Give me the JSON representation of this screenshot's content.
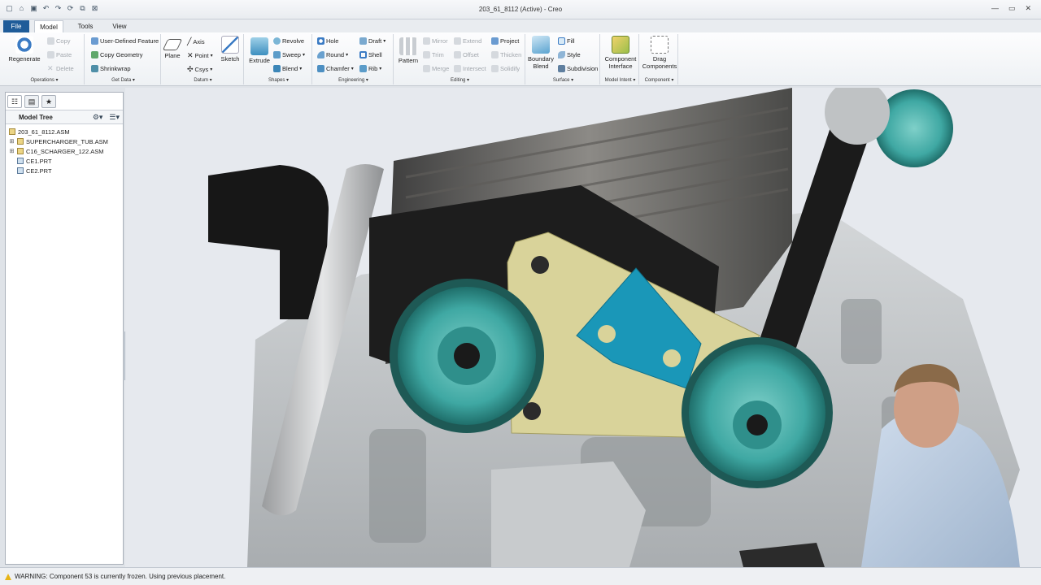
{
  "window": {
    "title": "203_61_8112 (Active) - Creo"
  },
  "quick_access": [
    "new-icon",
    "open-icon",
    "save-icon",
    "undo-icon",
    "redo-icon",
    "regenerate-icon",
    "windows-icon",
    "close-icon"
  ],
  "tabs": [
    {
      "label": "File"
    },
    {
      "label": "Model"
    },
    {
      "label": "Tools"
    },
    {
      "label": "View"
    }
  ],
  "ribbon": {
    "operations": {
      "label": "Operations ▾",
      "regenerate": "Regenerate",
      "copy": "Copy",
      "paste": "Paste",
      "delete": "Delete"
    },
    "get_data": {
      "label": "Get Data ▾",
      "udf": "User-Defined Feature",
      "copy_geometry": "Copy Geometry",
      "shrinkwrap": "Shrinkwrap"
    },
    "datum": {
      "label": "Datum ▾",
      "plane": "Plane",
      "axis": "Axis",
      "point": "Point",
      "csys": "Csys",
      "sketch": "Sketch"
    },
    "shapes": {
      "label": "Shapes ▾",
      "extrude": "Extrude",
      "revolve": "Revolve",
      "sweep": "Sweep",
      "blend": "Blend"
    },
    "engineering": {
      "label": "Engineering ▾",
      "hole": "Hole",
      "draft": "Draft",
      "round": "Round",
      "shell": "Shell",
      "chamfer": "Chamfer",
      "rib": "Rib"
    },
    "editing": {
      "label": "Editing ▾",
      "pattern": "Pattern",
      "mirror": "Mirror",
      "extend": "Extend",
      "project": "Project",
      "trim": "Trim",
      "offset": "Offset",
      "thicken": "Thicken",
      "merge": "Merge",
      "intersect": "Intersect",
      "solidify": "Solidify"
    },
    "surface": {
      "label": "Surface ▾",
      "boundary_blend_1": "Boundary",
      "boundary_blend_2": "Blend",
      "fill": "Fill",
      "style": "Style",
      "subdivision": "Subdivision"
    },
    "model_intent": {
      "label": "Model Intent ▾",
      "component_interface_1": "Component",
      "component_interface_2": "Interface"
    },
    "component": {
      "label": "Component ▾",
      "drag_components_1": "Drag",
      "drag_components_2": "Components"
    }
  },
  "model_tree": {
    "title": "Model Tree",
    "items": [
      {
        "label": "203_61_8112.ASM",
        "type": "assembly",
        "expandable": false
      },
      {
        "label": "SUPERCHARGER_TUB.ASM",
        "type": "assembly",
        "expandable": true
      },
      {
        "label": "C16_SCHARGER_122.ASM",
        "type": "assembly",
        "expandable": true
      },
      {
        "label": "CE1.PRT",
        "type": "part",
        "expandable": false
      },
      {
        "label": "CE2.PRT",
        "type": "part",
        "expandable": false
      }
    ]
  },
  "status": {
    "message": "WARNING: Component 53 is currently frozen. Using previous placement."
  },
  "colors": {
    "file_tab": "#1f5c99",
    "pulley_teal": "#3fa8a3",
    "bracket_yellow": "#d9d39a",
    "bracket_blue": "#1a97b8",
    "engine_grey": "#bfc3c6"
  }
}
